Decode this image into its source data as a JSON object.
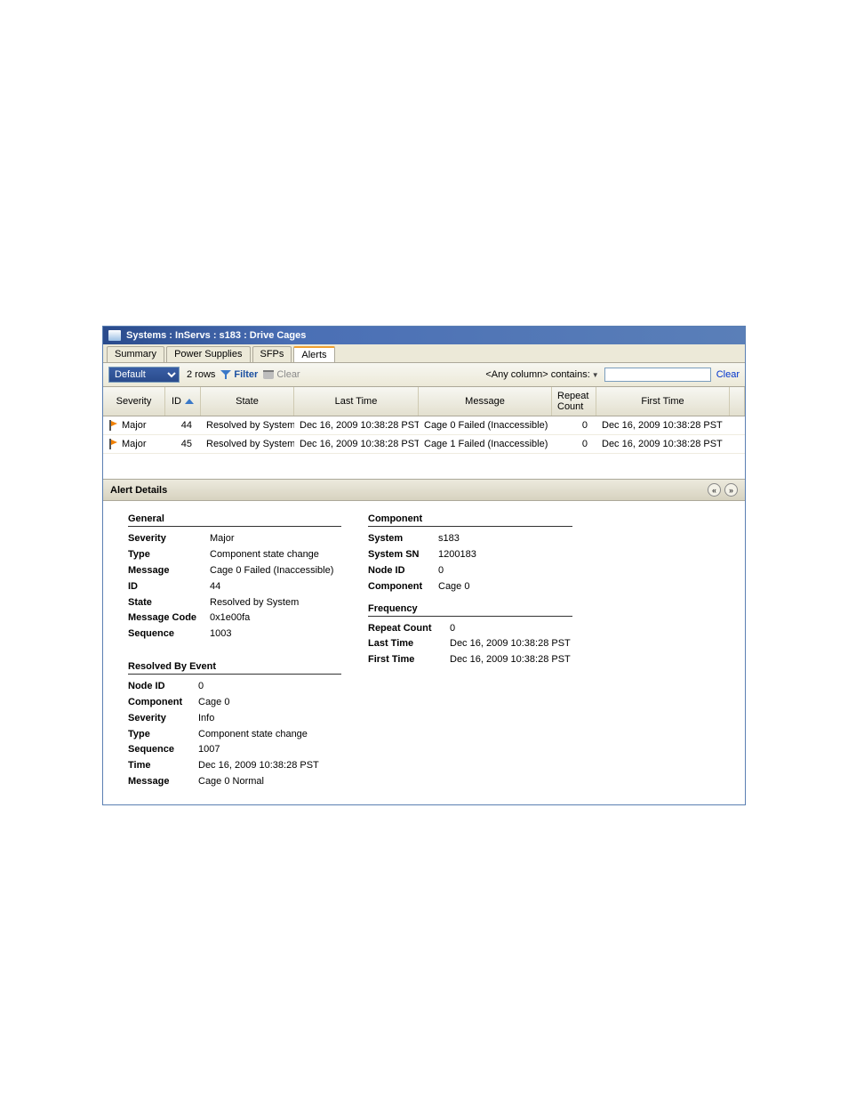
{
  "intro_link1": "",
  "intro_link2": "",
  "titlebar": {
    "path": "Systems : InServs : s183 : Drive Cages"
  },
  "tabs": [
    "Summary",
    "Power Supplies",
    "SFPs",
    "Alerts"
  ],
  "active_tab": 3,
  "toolbar": {
    "view": "Default",
    "row_count": "2 rows",
    "filter": "Filter",
    "clear_btn": "Clear",
    "any_column": "<Any column> contains:",
    "clear_link": "Clear"
  },
  "columns": {
    "sev": "Severity",
    "id": "ID",
    "state": "State",
    "ltime": "Last Time",
    "msg": "Message",
    "rc": "Repeat Count",
    "ftime": "First Time"
  },
  "rows": [
    {
      "sev": "Major",
      "id": "44",
      "state": "Resolved by System",
      "ltime": "Dec 16, 2009 10:38:28 PST",
      "msg": "Cage 0 Failed (Inaccessible)",
      "rc": "0",
      "ftime": "Dec 16, 2009 10:38:28 PST"
    },
    {
      "sev": "Major",
      "id": "45",
      "state": "Resolved by System",
      "ltime": "Dec 16, 2009 10:38:28 PST",
      "msg": "Cage 1 Failed (Inaccessible)",
      "rc": "0",
      "ftime": "Dec 16, 2009 10:38:28 PST"
    }
  ],
  "details_header": "Alert Details",
  "general": {
    "title": "General",
    "severity": {
      "k": "Severity",
      "v": "Major"
    },
    "type": {
      "k": "Type",
      "v": "Component state change"
    },
    "message": {
      "k": "Message",
      "v": "Cage 0 Failed (Inaccessible)"
    },
    "id": {
      "k": "ID",
      "v": "44"
    },
    "state": {
      "k": "State",
      "v": "Resolved by System"
    },
    "msgcode": {
      "k": "Message Code",
      "v": "0x1e00fa"
    },
    "sequence": {
      "k": "Sequence",
      "v": "1003"
    }
  },
  "resolved": {
    "title": "Resolved By Event",
    "nodeid": {
      "k": "Node ID",
      "v": "0"
    },
    "component": {
      "k": "Component",
      "v": "Cage 0"
    },
    "severity": {
      "k": "Severity",
      "v": "Info"
    },
    "type": {
      "k": "Type",
      "v": "Component state change"
    },
    "sequence": {
      "k": "Sequence",
      "v": "1007"
    },
    "time": {
      "k": "Time",
      "v": "Dec 16, 2009 10:38:28 PST"
    },
    "message": {
      "k": "Message",
      "v": "Cage 0 Normal"
    }
  },
  "component": {
    "title": "Component",
    "system": {
      "k": "System",
      "v": "s183"
    },
    "systemsn": {
      "k": "System SN",
      "v": "1200183"
    },
    "nodeid": {
      "k": "Node ID",
      "v": "0"
    },
    "component": {
      "k": "Component",
      "v": "Cage 0"
    }
  },
  "frequency": {
    "title": "Frequency",
    "rc": {
      "k": "Repeat Count",
      "v": "0"
    },
    "last": {
      "k": "Last Time",
      "v": "Dec 16, 2009 10:38:28 PST"
    },
    "first": {
      "k": "First Time",
      "v": "Dec 16, 2009 10:38:28 PST"
    }
  }
}
